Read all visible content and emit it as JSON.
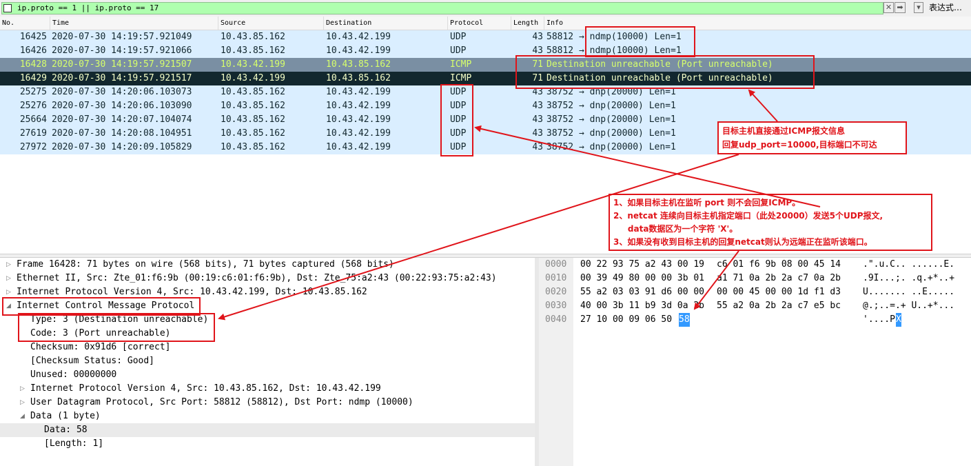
{
  "filter": {
    "expression": "ip.proto == 1 || ip.proto == 17",
    "clear_glyph": "✕",
    "apply_glyph": "➡",
    "dropdown_glyph": "▾",
    "expression_label": "表达式…"
  },
  "columns": [
    "No.",
    "Time",
    "Source",
    "Destination",
    "Protocol",
    "Length",
    "Info"
  ],
  "packets": [
    {
      "no": "16425",
      "time": "2020-07-30 14:19:57.921049",
      "src": "10.43.85.162",
      "dst": "10.43.42.199",
      "proto": "UDP",
      "len": "43",
      "info": "58812 → ndmp(10000) Len=1",
      "style": "udp"
    },
    {
      "no": "16426",
      "time": "2020-07-30 14:19:57.921066",
      "src": "10.43.85.162",
      "dst": "10.43.42.199",
      "proto": "UDP",
      "len": "43",
      "info": "58812 → ndmp(10000) Len=1",
      "style": "udp"
    },
    {
      "no": "16428",
      "time": "2020-07-30 14:19:57.921507",
      "src": "10.43.42.199",
      "dst": "10.43.85.162",
      "proto": "ICMP",
      "len": "71",
      "info": "Destination unreachable (Port unreachable)",
      "style": "icmp"
    },
    {
      "no": "16429",
      "time": "2020-07-30 14:19:57.921517",
      "src": "10.43.42.199",
      "dst": "10.43.85.162",
      "proto": "ICMP",
      "len": "71",
      "info": "Destination unreachable (Port unreachable)",
      "style": "icmp-selected"
    },
    {
      "no": "25275",
      "time": "2020-07-30 14:20:06.103073",
      "src": "10.43.85.162",
      "dst": "10.43.42.199",
      "proto": "UDP",
      "len": "43",
      "info": "38752 → dnp(20000) Len=1",
      "style": "udp"
    },
    {
      "no": "25276",
      "time": "2020-07-30 14:20:06.103090",
      "src": "10.43.85.162",
      "dst": "10.43.42.199",
      "proto": "UDP",
      "len": "43",
      "info": "38752 → dnp(20000) Len=1",
      "style": "udp"
    },
    {
      "no": "25664",
      "time": "2020-07-30 14:20:07.104074",
      "src": "10.43.85.162",
      "dst": "10.43.42.199",
      "proto": "UDP",
      "len": "43",
      "info": "38752 → dnp(20000) Len=1",
      "style": "udp"
    },
    {
      "no": "27619",
      "time": "2020-07-30 14:20:08.104951",
      "src": "10.43.85.162",
      "dst": "10.43.42.199",
      "proto": "UDP",
      "len": "43",
      "info": "38752 → dnp(20000) Len=1",
      "style": "udp"
    },
    {
      "no": "27972",
      "time": "2020-07-30 14:20:09.105829",
      "src": "10.43.85.162",
      "dst": "10.43.42.199",
      "proto": "UDP",
      "len": "43",
      "info": "38752 → dnp(20000) Len=1",
      "style": "udp"
    }
  ],
  "row_colors": {
    "udp": {
      "bg": "#daeeff",
      "fg": "#12272e"
    },
    "icmp": {
      "bg": "#7a8fa3",
      "fg": "#d6ff6b"
    },
    "icmp-selected": {
      "bg": "#12272e",
      "fg": "#f5ffc8"
    }
  },
  "details": [
    {
      "text": "Frame 16428: 71 bytes on wire (568 bits), 71 bytes captured (568 bits)",
      "indent": 0,
      "toggle": "collapsed"
    },
    {
      "text": "Ethernet II, Src: Zte_01:f6:9b (00:19:c6:01:f6:9b), Dst: Zte_75:a2:43 (00:22:93:75:a2:43)",
      "indent": 0,
      "toggle": "collapsed"
    },
    {
      "text": "Internet Protocol Version 4, Src: 10.43.42.199, Dst: 10.43.85.162",
      "indent": 0,
      "toggle": "collapsed"
    },
    {
      "text": "Internet Control Message Protocol",
      "indent": 0,
      "toggle": "expanded"
    },
    {
      "text": "Type: 3 (Destination unreachable)",
      "indent": 1,
      "toggle": "none"
    },
    {
      "text": "Code: 3 (Port unreachable)",
      "indent": 1,
      "toggle": "none"
    },
    {
      "text": "Checksum: 0x91d6 [correct]",
      "indent": 1,
      "toggle": "none"
    },
    {
      "text": "[Checksum Status: Good]",
      "indent": 1,
      "toggle": "none"
    },
    {
      "text": "Unused: 00000000",
      "indent": 1,
      "toggle": "none"
    },
    {
      "text": "Internet Protocol Version 4, Src: 10.43.85.162, Dst: 10.43.42.199",
      "indent": 1,
      "toggle": "collapsed"
    },
    {
      "text": "User Datagram Protocol, Src Port: 58812 (58812), Dst Port: ndmp (10000)",
      "indent": 1,
      "toggle": "collapsed"
    },
    {
      "text": "Data (1 byte)",
      "indent": 1,
      "toggle": "expanded"
    },
    {
      "text": "Data: 58",
      "indent": 2,
      "toggle": "none",
      "highlight": true
    },
    {
      "text": "[Length: 1]",
      "indent": 2,
      "toggle": "none"
    }
  ],
  "bytes": [
    {
      "offset": "0000",
      "hex1": "00 22 93 75 a2 43 00 19",
      "hex2": "c6 01 f6 9b 08 00 45 14",
      "ascii": ".\".u.C.. ......E."
    },
    {
      "offset": "0010",
      "hex1": "00 39 49 80 00 00 3b 01",
      "hex2": "a1 71 0a 2b 2a c7 0a 2b",
      "ascii": ".9I...;. .q.+*..+"
    },
    {
      "offset": "0020",
      "hex1": "55 a2 03 03 91 d6 00 00",
      "hex2": "00 00 45 00 00 1d f1 d3",
      "ascii": "U....... ..E....."
    },
    {
      "offset": "0030",
      "hex1": "40 00 3b 11 b9 3d 0a 2b",
      "hex2": "55 a2 0a 2b 2a c7 e5 bc",
      "ascii": "@.;..=.+ U..+*..."
    },
    {
      "offset": "0040",
      "hex1": "27 10 00 09 06 50",
      "hex_selected": "58",
      "ascii": "'....P",
      "ascii_selected": "X"
    }
  ],
  "annotations": {
    "note1": "目标主机直接通过ICMP报文信息\n回复udp_port=10000,目标端口不可达",
    "note2": "1、如果目标主机在监听 port 则不会回复ICMP。\n2、netcat 连续向目标主机指定端口（此处20000）发送5个UDP报文,\n     data数据区为一个字符 'X'。\n3、如果没有收到目标主机的回复netcat则认为远端正在监听该端口。",
    "color": "#e0141a"
  }
}
